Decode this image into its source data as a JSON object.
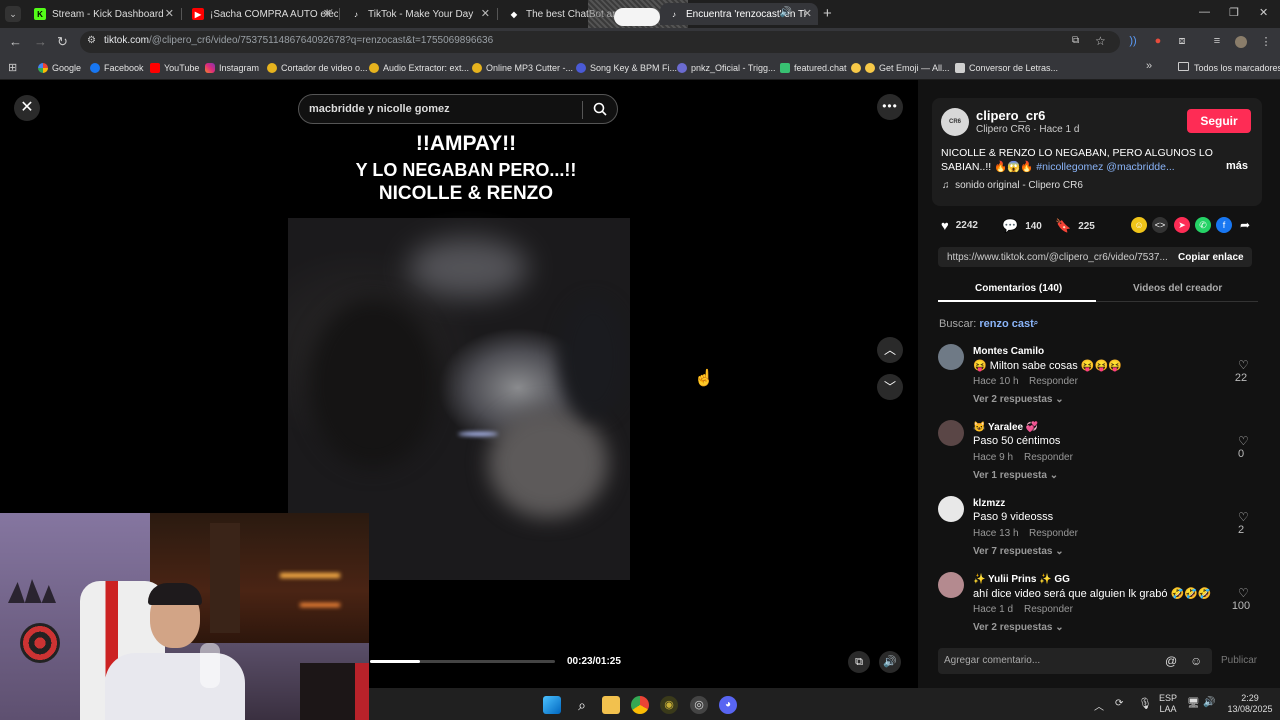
{
  "browser": {
    "tabs": [
      {
        "title": "Stream - Kick Dashboard",
        "active": false
      },
      {
        "title": "¡Sacha COMPRA AUTO eléc",
        "active": false
      },
      {
        "title": "TikTok - Make Your Day",
        "active": false
      },
      {
        "title": "The best ChatBot and Wid",
        "active": false
      },
      {
        "title": "Encuentra 'renzocast' en Ti",
        "active": true
      }
    ],
    "url_host": "tiktok.com",
    "url_path": "/@clipero_cr6/video/7537511486764092678?q=renzocast&t=1755069896636",
    "bookmarks": [
      "Google",
      "Facebook",
      "YouTube",
      "Instagram",
      "Cortador de video o...",
      "Audio Extractor: ext...",
      "Online MP3 Cutter -...",
      "Song Key & BPM Fi...",
      "pnkz_Oficial - Trigg...",
      "featured.chat",
      "Get Emoji — All...",
      "Conversor de Letras..."
    ],
    "all_bookmarks": "Todos los marcadores"
  },
  "video": {
    "search_query": "macbridde y nicolle gomez",
    "caption_line1": "!!AMPAY!!",
    "caption_line2": "Y LO NEGABAN PERO...!!",
    "caption_line3": "NICOLLE & RENZO",
    "time": "00:23/01:25",
    "progress": 0.27
  },
  "post": {
    "username": "clipero_cr6",
    "subtitle": "Clipero CR6 · Hace 1 d",
    "follow_label": "Seguir",
    "description_plain": "NICOLLE & RENZO LO NEGABAN, PERO ALGUNOS LO SABIAN..!! 🔥😱🔥 ",
    "description_tags": "#nicollegomez @macbridde...",
    "more_label": "más",
    "sound": "sonido original - Clipero CR6",
    "likes": "2242",
    "comments": "140",
    "saves": "225",
    "link": "https://www.tiktok.com/@clipero_cr6/video/7537...",
    "copy_label": "Copiar enlace",
    "tab_comments": "Comentarios (140)",
    "tab_creator": "Videos del creador",
    "search_label": "Buscar:",
    "search_term": "renzo cast"
  },
  "comments": [
    {
      "name": "Montes Camilo",
      "text": "😝 Milton sabe cosas 😝😝😝",
      "time": "Hace 10 h",
      "reply": "Responder",
      "replies": "Ver 2 respuestas",
      "likes": "22",
      "avatar_color": "#6f7a86"
    },
    {
      "name": "😺 Yaralee 💞",
      "text": "Paso 50 céntimos",
      "time": "Hace 9 h",
      "reply": "Responder",
      "replies": "Ver 1 respuesta",
      "likes": "0",
      "avatar_color": "#5a4646"
    },
    {
      "name": "klzmzz",
      "text": "Paso 9 videosss",
      "time": "Hace 13 h",
      "reply": "Responder",
      "replies": "Ver 7 respuestas",
      "likes": "2",
      "avatar_color": "#e8e8e8"
    },
    {
      "name": "✨ Yulii Prins ✨ GG",
      "text": "ahí dice video será que alguien lk grabó 🤣🤣🤣",
      "time": "Hace 1 d",
      "reply": "Responder",
      "replies": "Ver 2 respuestas",
      "likes": "100",
      "avatar_color": "#b48a8f"
    }
  ],
  "composer": {
    "placeholder": "Agregar comentario...",
    "publish": "Publicar"
  },
  "taskbar": {
    "lang1": "ESP",
    "lang2": "LAA",
    "time": "2:29",
    "date": "13/08/2025"
  }
}
